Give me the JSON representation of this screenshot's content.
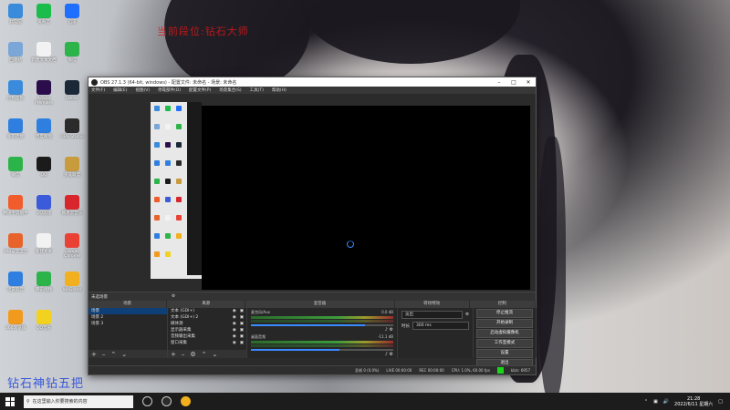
{
  "watermarks": {
    "top": "当前段位:钻石大师",
    "bottom": "钻石神钻五把"
  },
  "desktop_icons": [
    {
      "label": "此电脑",
      "color": "#3a8bdc"
    },
    {
      "label": "爱奇艺",
      "color": "#1abc4a"
    },
    {
      "label": "迅雷",
      "color": "#1f6fff"
    },
    {
      "label": "回收站",
      "color": "#7aa7d8"
    },
    {
      "label": "新建文本文档",
      "color": "#f2f2f2"
    },
    {
      "label": "微信",
      "color": "#2cb44a"
    },
    {
      "label": "控制面板",
      "color": "#3a8bdc"
    },
    {
      "label": "Adobe Premiere",
      "color": "#2a0d4a"
    },
    {
      "label": "Steam",
      "color": "#1b2838"
    },
    {
      "label": "宽带连接",
      "color": "#2f7fe0"
    },
    {
      "label": "百度网盘",
      "color": "#2f7fe0"
    },
    {
      "label": "OBS Studio",
      "color": "#2b2b2b"
    },
    {
      "label": "微信",
      "color": "#2cb44a"
    },
    {
      "label": "QQ",
      "color": "#1b1b1b"
    },
    {
      "label": "英雄联盟",
      "color": "#c89b3c"
    },
    {
      "label": "腾讯手游助手",
      "color": "#f25c2c"
    },
    {
      "label": "QQ游戏",
      "color": "#3b5bdb"
    },
    {
      "label": "网易云音乐",
      "color": "#d9252c"
    },
    {
      "label": "360安全卫士",
      "color": "#e8632b"
    },
    {
      "label": "新建文本",
      "color": "#f2f2f2"
    },
    {
      "label": "Google Chrome",
      "color": "#e94235"
    },
    {
      "label": "迅雷影音",
      "color": "#2f7fe0"
    },
    {
      "label": "腾讯视频",
      "color": "#2cb44a"
    },
    {
      "label": "WeGame",
      "color": "#f2b01e"
    },
    {
      "label": "360浏览器",
      "color": "#f29a1e"
    },
    {
      "label": "QQ音乐",
      "color": "#f2d21e"
    }
  ],
  "obs": {
    "title": "OBS 27.1.3 (64-bit, windows) - 配置文件: 未命名 - 场景: 未命名",
    "menu": [
      "文件(F)",
      "编辑(E)",
      "视图(V)",
      "停靠部件(D)",
      "配置文件(P)",
      "场景集合(S)",
      "工具(T)",
      "帮助(H)"
    ],
    "scene_strip_label": "未选场景",
    "dock_headers": {
      "scenes": "场景",
      "sources": "来源",
      "mixer": "混音器",
      "transitions": "转场特效",
      "controls": "控制"
    },
    "scenes": [
      "场景",
      "场景 2",
      "场景 3"
    ],
    "sources": [
      "文本 (GDI+)",
      "文本 (GDI+) 2",
      "媒体源",
      "显示器采集",
      "音频输出采集",
      "窗口采集"
    ],
    "mixer": [
      {
        "name": "麦克风/Aux",
        "db": "0.0 dB",
        "level": 0.8
      },
      {
        "name": "桌面音频",
        "db": "-11.1 dB",
        "level": 0.62
      }
    ],
    "transition": {
      "value": "淡出",
      "duration_label": "时长",
      "duration": "300 ms"
    },
    "controls": [
      "停止推流",
      "开始录制",
      "启动虚拟摄像机",
      "工作室模式",
      "设置",
      "退出"
    ],
    "status": {
      "dropped": "丢帧 0 (0.0%)",
      "live": "LIVE 00:00:00",
      "rec": "REC 00:00:00",
      "cpu": "CPU: 1.0%, 60.00 fps",
      "bitrate": "kb/s: 6957"
    },
    "status_ok_color": "#19d619"
  },
  "taskbar": {
    "search_placeholder": "在这里输入你要搜索的内容",
    "time": "21:28",
    "date": "2022/6/11 星期六"
  }
}
